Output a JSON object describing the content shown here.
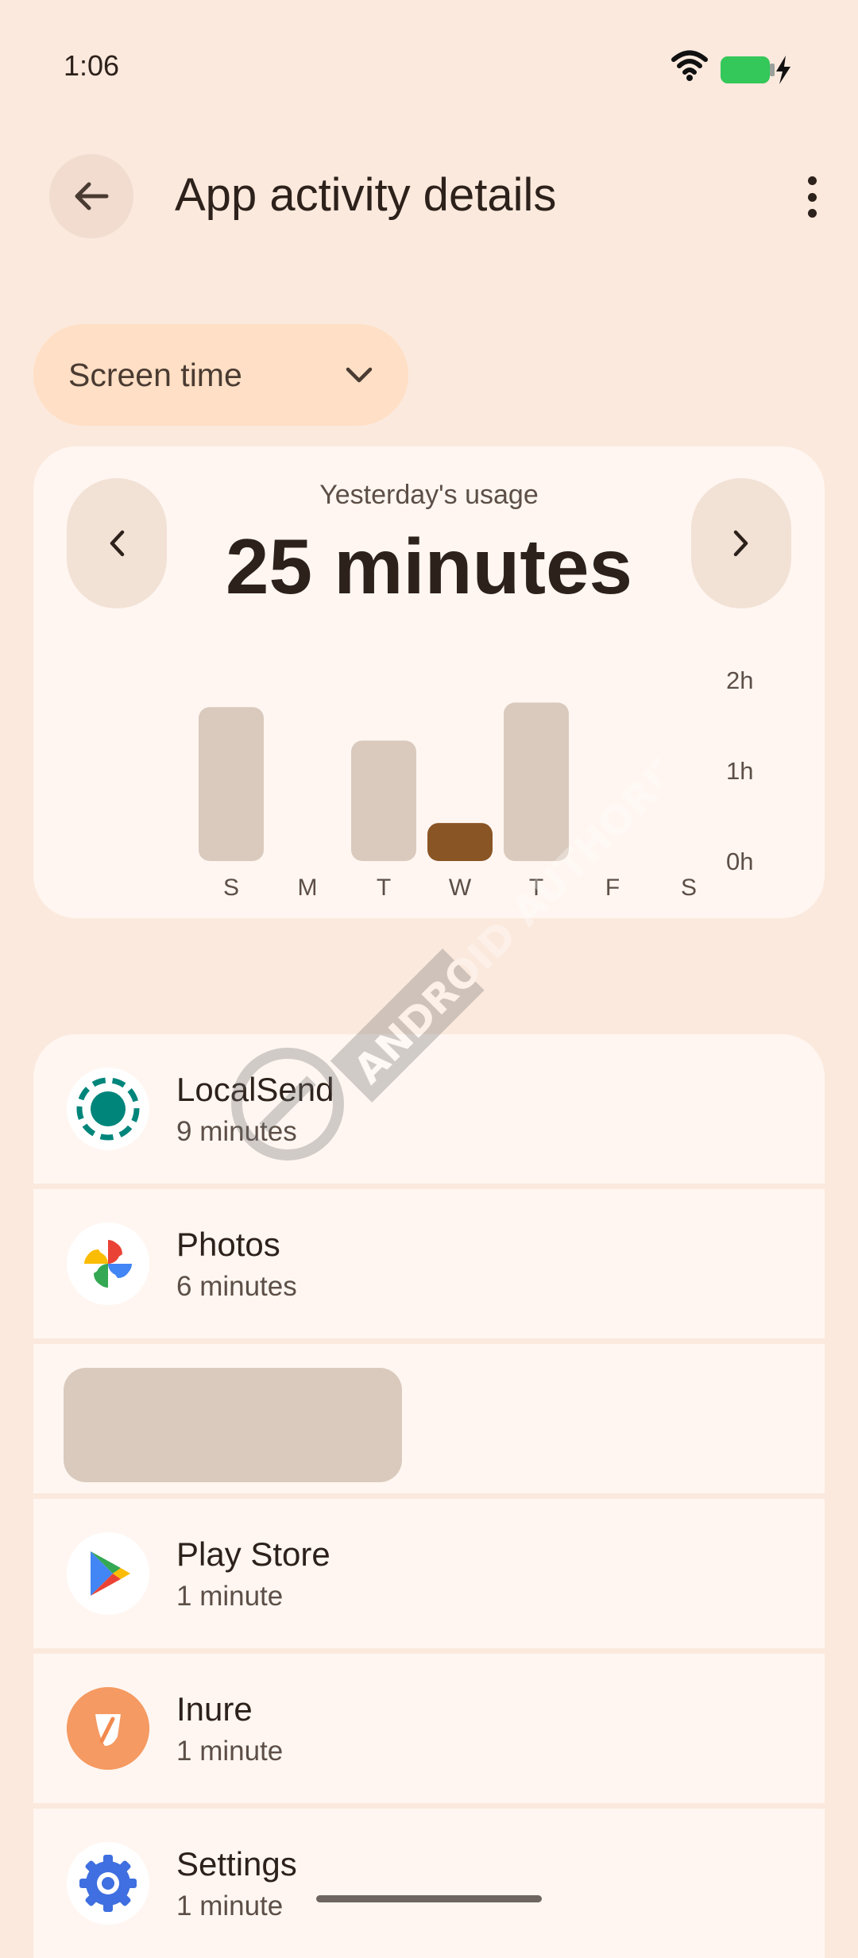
{
  "status_bar": {
    "time": "1:06"
  },
  "header": {
    "title": "App activity details"
  },
  "dropdown": {
    "selected": "Screen time"
  },
  "summary": {
    "caption": "Yesterday's usage",
    "value": "25 minutes"
  },
  "chart_data": {
    "type": "bar",
    "categories": [
      "S",
      "M",
      "T",
      "W",
      "T",
      "F",
      "S"
    ],
    "values": [
      1.7,
      null,
      1.33,
      0.42,
      1.75,
      null,
      null
    ],
    "highlight_index": 3,
    "y_ticks": [
      "2h",
      "1h",
      "0h"
    ],
    "ylim": [
      0,
      2
    ],
    "colors": {
      "bar": "#d9cabd",
      "highlight": "#8a5524"
    }
  },
  "apps": [
    {
      "name": "LocalSend",
      "time": "9 minutes",
      "icon": "localsend-icon"
    },
    {
      "name": "Photos",
      "time": "6 minutes",
      "icon": "photos-icon"
    },
    {
      "name": "",
      "time": "",
      "icon": ""
    },
    {
      "name": "Play Store",
      "time": "1 minute",
      "icon": "play-store-icon"
    },
    {
      "name": "Inure",
      "time": "1 minute",
      "icon": "inure-icon"
    },
    {
      "name": "Settings",
      "time": "1 minute",
      "icon": "settings-icon"
    }
  ],
  "watermark": {
    "text": "ANDROID AUTHORITY"
  },
  "colors": {
    "background": "#fbe9dd",
    "card": "#fff6f1",
    "accent": "#ffdfc5"
  }
}
